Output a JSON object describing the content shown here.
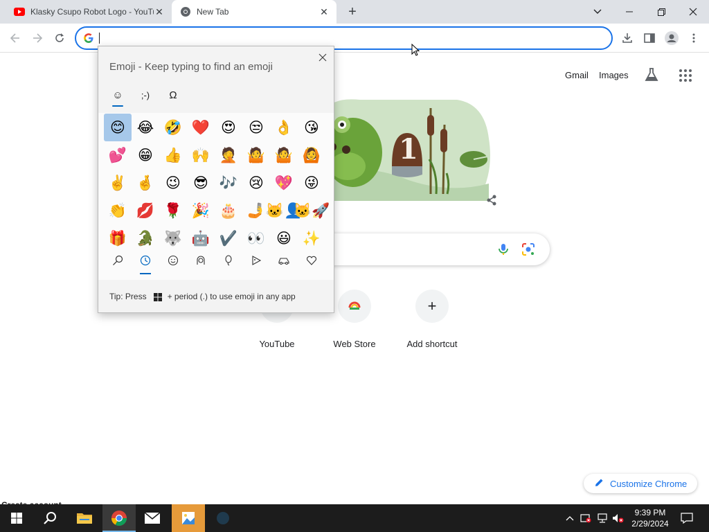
{
  "browser": {
    "tabs": [
      {
        "title": "Klasky Csupo Robot Logo - YouTube",
        "icon": "youtube-icon",
        "active": false
      },
      {
        "title": "New Tab",
        "icon": "chrome-icon",
        "active": true
      }
    ],
    "omnibox": {
      "value": "",
      "placeholder": ""
    }
  },
  "ntp": {
    "links": {
      "gmail": "Gmail",
      "images": "Images"
    },
    "shortcuts": [
      {
        "label": "YouTube"
      },
      {
        "label": "Web Store"
      },
      {
        "label": "Add shortcut",
        "icon": "+"
      }
    ],
    "customize_label": "Customize Chrome",
    "doodle_number": "1"
  },
  "emoji_panel": {
    "title": "Emoji - Keep typing to find an emoji",
    "categories": [
      "☺",
      ";-)",
      "Ω"
    ],
    "grid": [
      [
        "😊",
        "😂",
        "🤣",
        "❤️",
        "😍",
        "😒",
        "👌",
        "😘"
      ],
      [
        "💕",
        "😁",
        "👍",
        "🙌",
        "🤦",
        "🤷",
        "🤷",
        "🙆"
      ],
      [
        "✌️",
        "🤞",
        "😉",
        "😎",
        "🎶",
        "😢",
        "💖",
        "😜"
      ],
      [
        "👏",
        "💋",
        "🌹",
        "🎉",
        "🎂",
        "🤳",
        "🐱‍👤",
        "🐱‍🚀"
      ],
      [
        "🎁",
        "🐊",
        "🐺",
        "🤖",
        "✔️",
        "👀",
        "😃",
        "✨"
      ]
    ],
    "bottom_nav": [
      "search",
      "recent",
      "smileys",
      "people",
      "celebrations",
      "food",
      "travel",
      "symbols"
    ],
    "footer": {
      "prefix": "Tip: Press",
      "suffix": "+ period (.) to use emoji in any app"
    }
  },
  "taskbar": {
    "clock_time": "9:39 PM",
    "clock_date": "2/29/2024",
    "overlay_text": "Create account"
  }
}
